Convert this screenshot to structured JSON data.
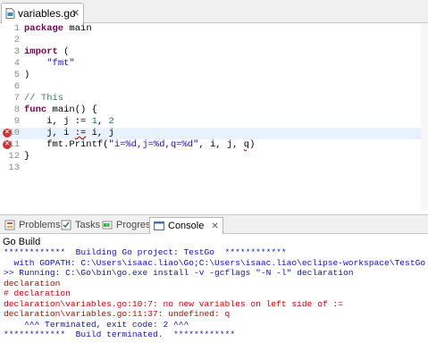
{
  "editor": {
    "tab_label": "variables.go",
    "close_glyph": "✕",
    "lines": [
      {
        "n": "1",
        "tokens": [
          [
            "kw",
            "package"
          ],
          [
            "plain",
            " main"
          ]
        ]
      },
      {
        "n": "2",
        "tokens": []
      },
      {
        "n": "3",
        "tokens": [
          [
            "kw",
            "import"
          ],
          [
            "plain",
            " ("
          ]
        ]
      },
      {
        "n": "4",
        "tokens": [
          [
            "plain",
            "    "
          ],
          [
            "str",
            "\"fmt\""
          ]
        ]
      },
      {
        "n": "5",
        "tokens": [
          [
            "plain",
            ")"
          ]
        ]
      },
      {
        "n": "6",
        "tokens": []
      },
      {
        "n": "7",
        "tokens": [
          [
            "cmt",
            "// This"
          ]
        ]
      },
      {
        "n": "8",
        "tokens": [
          [
            "kw",
            "func"
          ],
          [
            "plain",
            " main() {"
          ]
        ]
      },
      {
        "n": "9",
        "tokens": [
          [
            "plain",
            "    i, j := "
          ],
          [
            "num",
            "1"
          ],
          [
            "plain",
            ", "
          ],
          [
            "num",
            "2"
          ]
        ]
      },
      {
        "n": "10",
        "error": true,
        "current": true,
        "tokens": [
          [
            "plain",
            "    j, i "
          ],
          [
            "squig",
            ":="
          ],
          [
            "plain",
            " i, j"
          ]
        ]
      },
      {
        "n": "11",
        "error": true,
        "tokens": [
          [
            "plain",
            "    fmt.Printf("
          ],
          [
            "str",
            "\"i=%d,j=%d,q=%d\""
          ],
          [
            "plain",
            ", i, j, "
          ],
          [
            "squig",
            "q"
          ],
          [
            "plain",
            ")"
          ]
        ]
      },
      {
        "n": "12",
        "tokens": [
          [
            "plain",
            "}"
          ]
        ]
      },
      {
        "n": "13",
        "tokens": []
      }
    ]
  },
  "views": {
    "tabs": [
      {
        "label": "Problems",
        "icon": "problems-icon"
      },
      {
        "label": "Tasks",
        "icon": "tasks-icon"
      },
      {
        "label": "Progress",
        "icon": "progress-icon"
      },
      {
        "label": "Console",
        "icon": "console-icon",
        "active": true
      }
    ]
  },
  "console": {
    "title": "Go Build",
    "lines": [
      {
        "color": "blue",
        "text": "************  Building Go project: TestGo  ************"
      },
      {
        "color": "blue",
        "text": "  with GOPATH: C:\\Users\\isaac.liao\\Go;C:\\Users\\isaac.liao\\eclipse-workspace\\TestGo"
      },
      {
        "color": "blue",
        "text": ">> Running: C:\\Go\\bin\\go.exe install -v -gcflags \"-N -l\" declaration"
      },
      {
        "color": "red",
        "text": "declaration"
      },
      {
        "color": "red",
        "text": "# declaration"
      },
      {
        "color": "red",
        "text": "declaration\\variables.go:10:7: no new variables on left side of :="
      },
      {
        "color": "red",
        "text": "declaration\\variables.go:11:37: undefined: q"
      },
      {
        "color": "blue",
        "text": "    ^^^ Terminated, exit code: 2 ^^^"
      },
      {
        "color": "blue",
        "text": "************  Build terminated.  ************"
      }
    ]
  },
  "colors": {
    "keyword": "#7f0055",
    "string": "#2a00ff",
    "comment": "#3f7f5f",
    "console_info": "#1010cc",
    "console_error": "#d00000"
  }
}
